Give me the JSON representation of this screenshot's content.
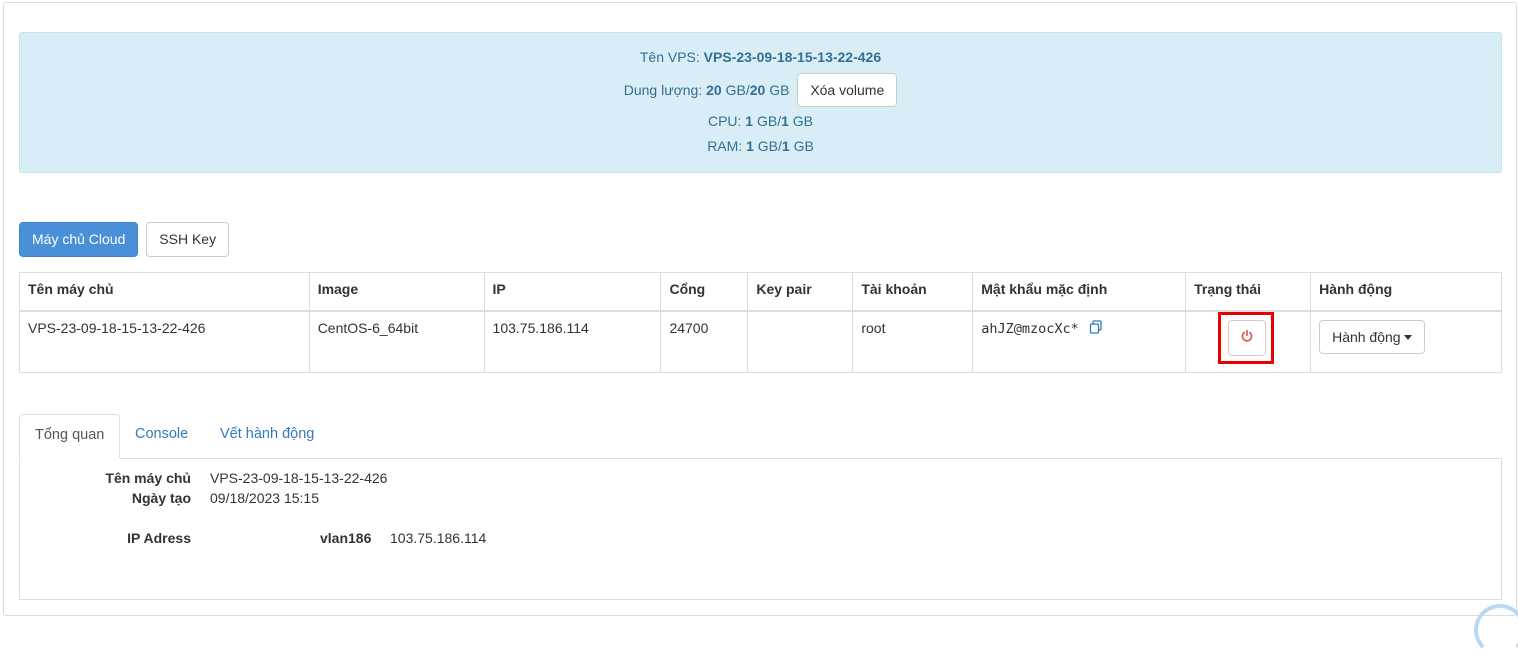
{
  "info": {
    "vps_name_label": "Tên VPS:",
    "vps_name": "VPS-23-09-18-15-13-22-426",
    "storage_label": "Dung lượng:",
    "storage_used": "20",
    "storage_sep": "GB/",
    "storage_total": "20",
    "storage_unit": "GB",
    "delete_volume": "Xóa volume",
    "cpu_label": "CPU:",
    "cpu_used": "1",
    "cpu_sep": "GB/",
    "cpu_total": "1",
    "cpu_unit": "GB",
    "ram_label": "RAM:",
    "ram_used": "1",
    "ram_sep": "GB/",
    "ram_total": "1",
    "ram_unit": "GB"
  },
  "toolbar": {
    "cloud_server": "Máy chủ Cloud",
    "ssh_key": "SSH Key"
  },
  "table": {
    "headers": [
      "Tên máy chủ",
      "Image",
      "IP",
      "Cổng",
      "Key pair",
      "Tài khoản",
      "Mật khẩu mặc định",
      "Trạng thái",
      "Hành động"
    ],
    "row": {
      "name": "VPS-23-09-18-15-13-22-426",
      "image": "CentOS-6_64bit",
      "ip": "103.75.186.114",
      "port": "24700",
      "key_pair": "",
      "account": "root",
      "password": "ahJZ@mzocXc*",
      "status_icon": "power-icon",
      "action_label": "Hành động"
    }
  },
  "tabs": [
    "Tổng quan",
    "Console",
    "Vết hành động"
  ],
  "overview": {
    "server_name_label": "Tên máy chủ",
    "server_name": "VPS-23-09-18-15-13-22-426",
    "created_label": "Ngày tạo",
    "created": "09/18/2023 15:15",
    "ip_label": "IP Adress",
    "vlan": "vlan186",
    "vlan_ip": "103.75.186.114"
  },
  "colors": {
    "info_bg": "#d9edf7",
    "info_text": "#31708f",
    "primary": "#4a90d9",
    "power_icon": "#d9534f",
    "highlight": "#e60000"
  }
}
